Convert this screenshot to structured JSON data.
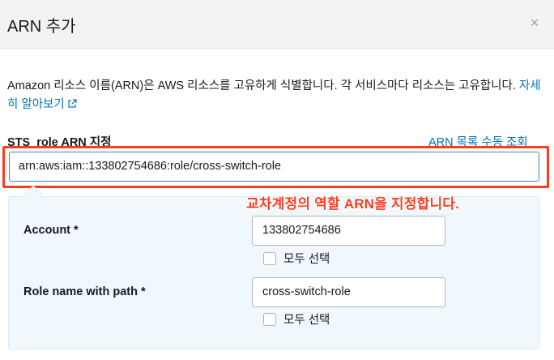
{
  "dialog": {
    "title": "ARN 추가",
    "close_icon": "×"
  },
  "description": {
    "text": "Amazon 리소스 이름(ARN)은 AWS 리소스를 고유하게 식별합니다. 각 서비스마다 리소스는 고유합니다.",
    "learn_more": "자세히 알아보기"
  },
  "sts_field": {
    "label": "STS_role ARN 지정",
    "manual_link": "ARN 목록 수동 조회",
    "value": "arn:aws:iam::133802754686:role/cross-switch-role"
  },
  "annotation": "교차계정의 역할 ARN을 지정합니다.",
  "account": {
    "label": "Account *",
    "value": "133802754686",
    "select_all": "모두 선택"
  },
  "role_name": {
    "label": "Role name with path *",
    "value": "cross-switch-role",
    "select_all": "모두 선택"
  },
  "colors": {
    "accent": "#0073bb",
    "highlight": "#ff3b1f",
    "panel_bg": "#f1f8fd"
  }
}
